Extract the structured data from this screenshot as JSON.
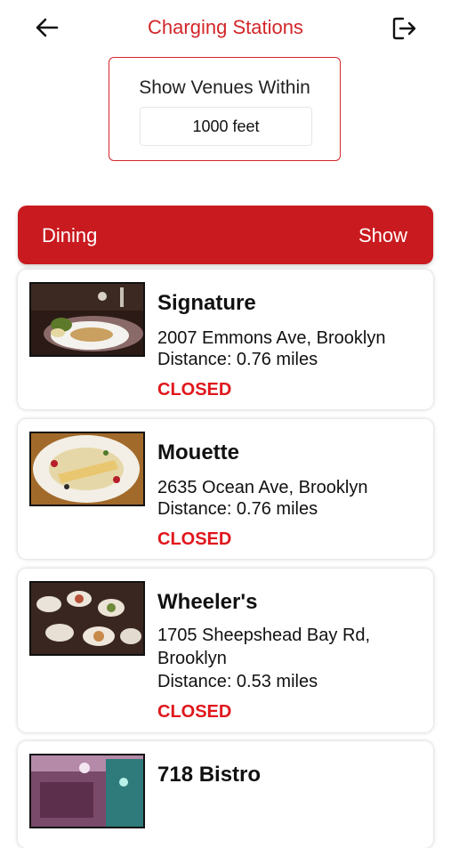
{
  "header": {
    "title": "Charging Stations",
    "back_icon": "arrow-left-icon",
    "logout_icon": "logout-icon"
  },
  "filter": {
    "label": "Show Venues Within",
    "value": "1000 feet"
  },
  "category": {
    "name": "Dining",
    "action": "Show"
  },
  "venues": [
    {
      "name": "Signature",
      "address": "2007 Emmons Ave, Brooklyn",
      "distance": "Distance: 0.76 miles",
      "status": "CLOSED"
    },
    {
      "name": "Mouette",
      "address": "2635 Ocean Ave, Brooklyn",
      "distance": "Distance: 0.76 miles",
      "status": "CLOSED"
    },
    {
      "name": "Wheeler's",
      "address": "1705 Sheepshead Bay Rd, Brooklyn",
      "distance": "Distance: 0.53 miles",
      "status": "CLOSED"
    },
    {
      "name": "718 Bistro"
    }
  ],
  "colors": {
    "accent": "#d3262a",
    "category_bar": "#c91a1f",
    "closed": "#e0171d"
  }
}
